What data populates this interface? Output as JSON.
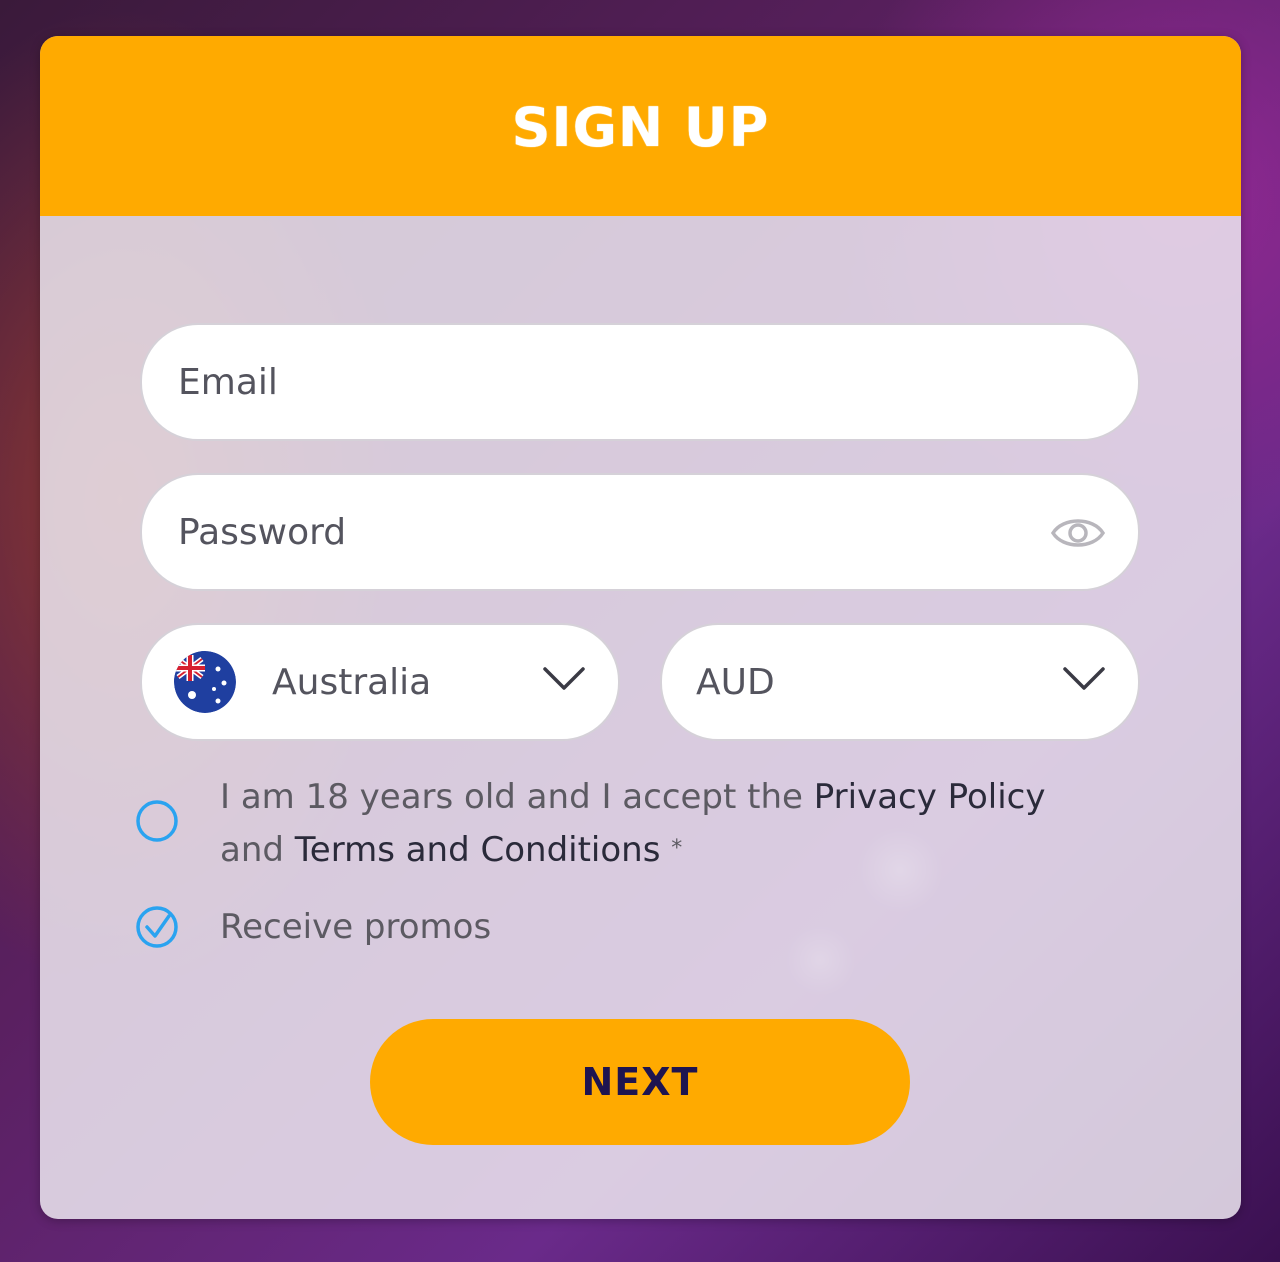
{
  "header": {
    "title": "SIGN UP"
  },
  "form": {
    "email": {
      "placeholder": "Email",
      "value": ""
    },
    "password": {
      "placeholder": "Password",
      "value": "",
      "toggle_icon": "eye-icon"
    },
    "country": {
      "selected": "Australia",
      "flag_icon": "australia-flag-icon"
    },
    "currency": {
      "selected": "AUD"
    },
    "terms": {
      "checked": false,
      "text_prefix": "I am 18 years old and I accept the ",
      "privacy_link": "Privacy Policy",
      "text_middle": "and ",
      "terms_link": "Terms and Conditions",
      "required_mark": "*"
    },
    "promos": {
      "checked": true,
      "label": "Receive promos"
    },
    "next_label": "NEXT"
  },
  "colors": {
    "accent": "#ffaa00",
    "button_text": "#1e1450",
    "checkbox": "#2aa3f0"
  }
}
